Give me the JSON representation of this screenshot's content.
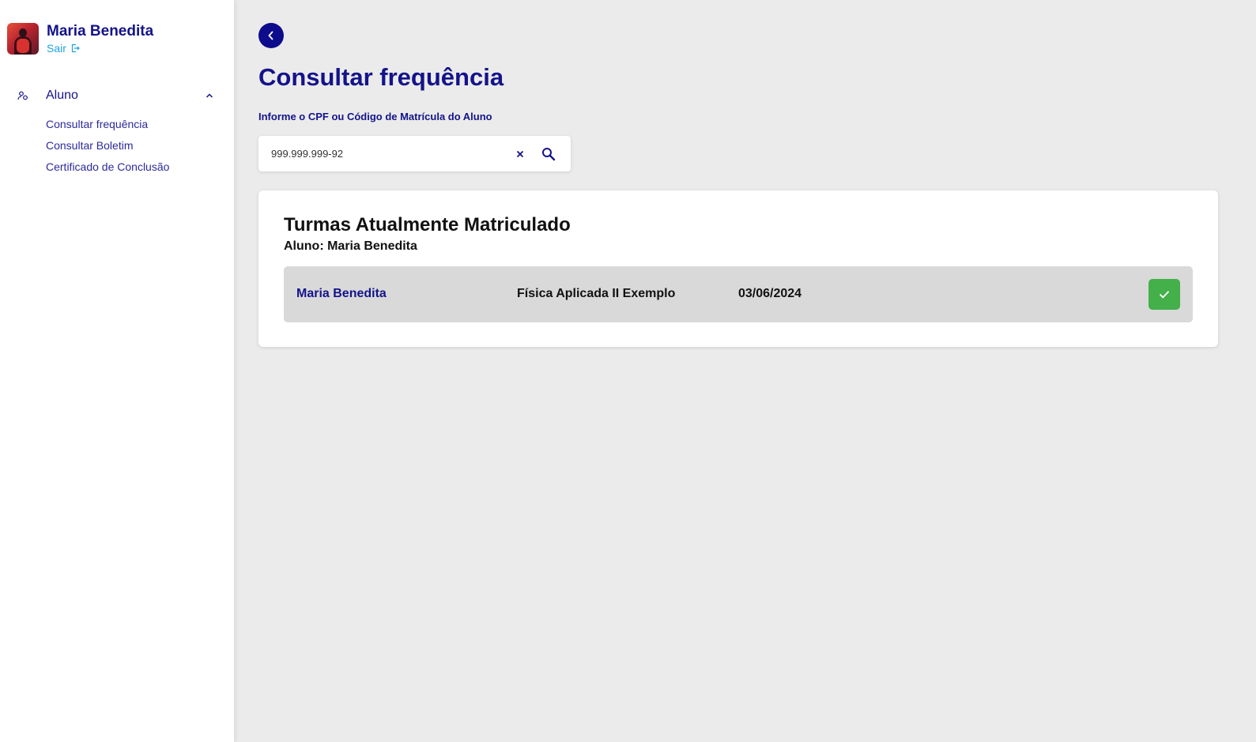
{
  "user": {
    "name": "Maria Benedita",
    "logout_label": "Sair"
  },
  "sidebar": {
    "group": {
      "label": "Aluno",
      "expanded": true,
      "items": [
        {
          "label": "Consultar frequência"
        },
        {
          "label": "Consultar Boletim"
        },
        {
          "label": "Certificado de Conclusão"
        }
      ]
    }
  },
  "main": {
    "title": "Consultar frequência",
    "search": {
      "label": "Informe o CPF ou Código de Matrícula do Aluno",
      "value": "999.999.999-92"
    },
    "card": {
      "title": "Turmas Atualmente Matriculado",
      "subtitle": "Aluno: Maria Benedita",
      "rows": [
        {
          "name": "Maria Benedita",
          "course": "Física Aplicada II Exemplo",
          "date": "03/06/2024"
        }
      ]
    }
  },
  "colors": {
    "primary": "#14138a",
    "link": "#1ea0e6",
    "success": "#43b04a",
    "background": "#ebebeb"
  },
  "icons": {
    "back": "chevron-left-icon",
    "logout": "logout-icon",
    "group": "users-icon",
    "collapse": "chevron-up-icon",
    "clear": "close-icon",
    "search": "search-icon",
    "confirm": "check-icon"
  }
}
